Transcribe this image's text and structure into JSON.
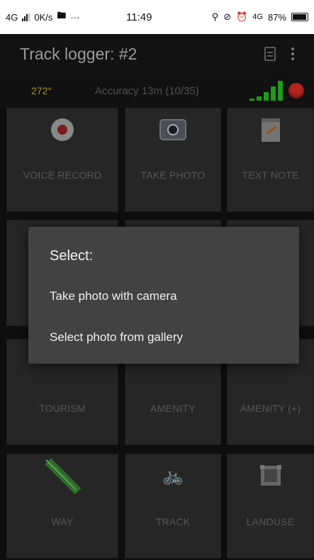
{
  "status_bar": {
    "network": "4G",
    "speed": "0K/s",
    "more": "···",
    "time": "11:49",
    "network_right": "4G",
    "battery": "87%"
  },
  "toolbar": {
    "title": "Track logger: #2",
    "icons": [
      "document-icon",
      "more-vert-icon"
    ]
  },
  "info": {
    "heading": "272°",
    "accuracy": "Accuracy 13m (10/35)",
    "signal_level": 5,
    "colors": {
      "heading": "#a69316",
      "signal": "#1f9a1a",
      "record": "#b5241d"
    }
  },
  "tiles": {
    "voice": {
      "label": "VOICE RECORD",
      "icon": "record-icon"
    },
    "photo": {
      "label": "TAKE PHOTO",
      "icon": "camera-icon"
    },
    "note": {
      "label": "TEXT NOTE",
      "icon": "note-icon"
    },
    "tourism": {
      "label": "TOURISM"
    },
    "amenity": {
      "label": "AMENITY"
    },
    "amenity_plus": {
      "label": "AMENITY (+)"
    },
    "way": {
      "label": "WAY",
      "icon": "road-icon"
    },
    "track": {
      "label": "TRACK",
      "icon": "bicycle-icon"
    },
    "landuse": {
      "label": "LANDUSE",
      "icon": "landuse-icon"
    }
  },
  "dialog": {
    "title": "Select:",
    "options": [
      "Take photo with camera",
      "Select photo from gallery"
    ]
  }
}
